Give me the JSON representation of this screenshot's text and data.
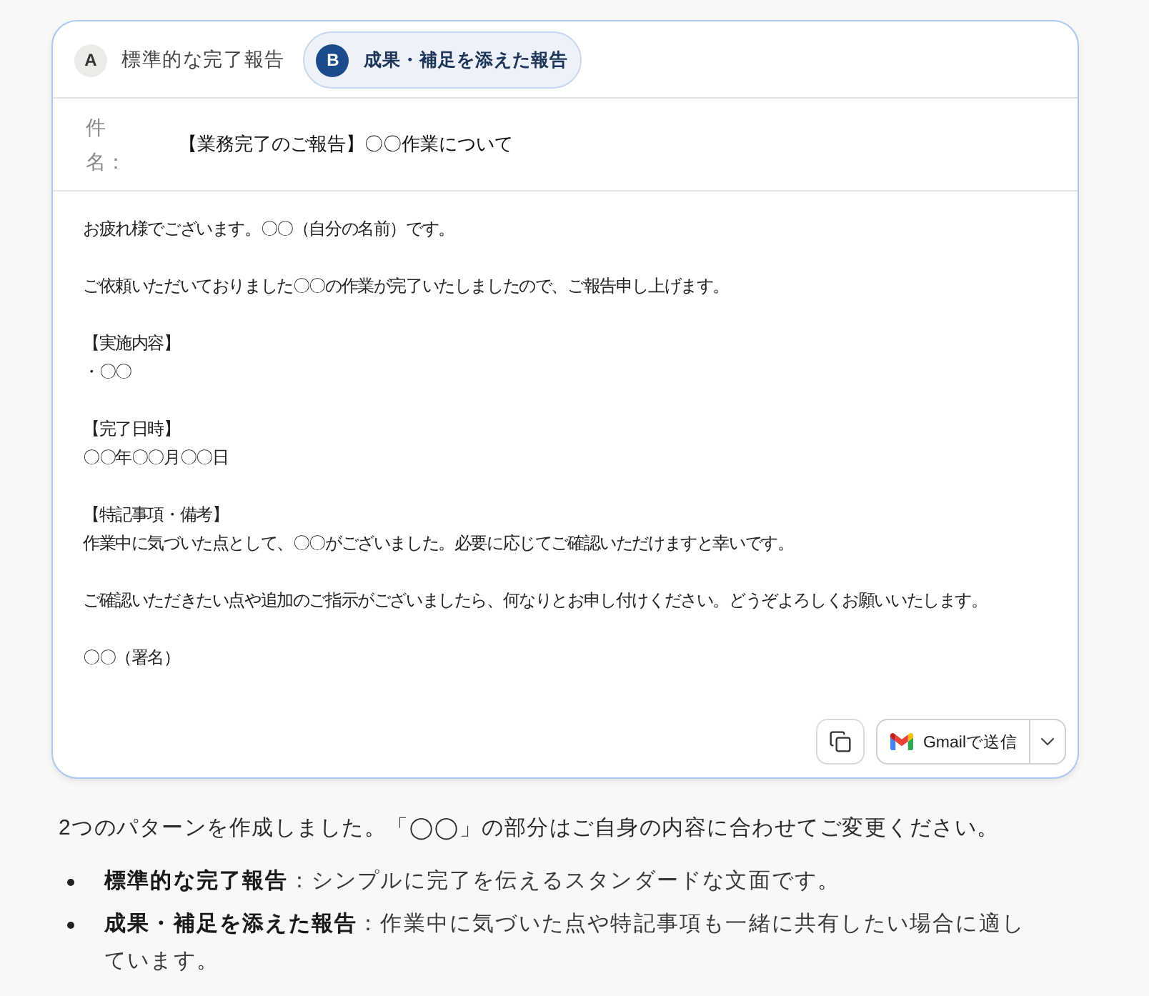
{
  "tabs": [
    {
      "badge": "A",
      "label": "標準的な完了報告",
      "selected": false
    },
    {
      "badge": "B",
      "label": "成果・補足を添えた報告",
      "selected": true
    }
  ],
  "subject": {
    "label": "件名：",
    "value": "【業務完了のご報告】〇〇作業について"
  },
  "body": [
    [
      "お疲れ様でございます。〇〇（自分の名前）です。"
    ],
    [
      "ご依頼いただいておりました〇〇の作業が完了いたしましたので、ご報告申し上げます。"
    ],
    [
      "【実施内容】",
      "・〇〇"
    ],
    [
      "【完了日時】",
      "〇〇年〇〇月〇〇日"
    ],
    [
      "【特記事項・備考】",
      "作業中に気づいた点として、〇〇がございました。必要に応じてご確認いただけますと幸いです。"
    ],
    [
      "ご確認いただきたい点や追加のご指示がございましたら、何なりとお申し付けください。どうぞよろしくお願いいたします。"
    ],
    [
      "〇〇（署名）"
    ]
  ],
  "actions": {
    "send_button": "Gmailで送信"
  },
  "summary": {
    "intro": "2つのパターンを作成しました。「◯◯」の部分はご自身の内容に合わせてご変更ください。",
    "items": [
      "**標準的な完了報告**：シンプルに完了を伝えるスタンダードな文面です。",
      "**成果・補足を添えた報告**：作業中に気づいた点や特記事項も一緒に共有したい場合に適しています。"
    ]
  }
}
